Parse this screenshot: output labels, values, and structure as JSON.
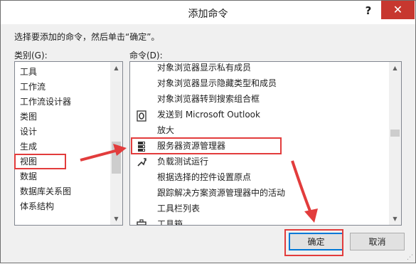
{
  "window": {
    "title": "添加命令",
    "help_label": "?",
    "close_label": "✕"
  },
  "instruction": "选择要添加的命令，然后单击“确定”。",
  "category_label": "类别(G):",
  "command_label": "命令(D):",
  "categories": [
    {
      "label": "工具"
    },
    {
      "label": "工作流"
    },
    {
      "label": "工作流设计器"
    },
    {
      "label": "类图"
    },
    {
      "label": "设计"
    },
    {
      "label": "生成"
    },
    {
      "label": "视图",
      "selected": true
    },
    {
      "label": "数据"
    },
    {
      "label": "数据库关系图"
    },
    {
      "label": "体系结构"
    }
  ],
  "commands": [
    {
      "label": "对象浏览器显示私有成员",
      "icon": ""
    },
    {
      "label": "对象浏览器显示隐藏类型和成员",
      "icon": ""
    },
    {
      "label": "对象浏览器转到搜索组合框",
      "icon": ""
    },
    {
      "label": "发送到 Microsoft Outlook",
      "icon": "outlook-icon"
    },
    {
      "label": "放大",
      "icon": ""
    },
    {
      "label": "服务器资源管理器",
      "icon": "server-explorer-icon",
      "selected": true
    },
    {
      "label": "负载测试运行",
      "icon": "load-test-icon"
    },
    {
      "label": "根据选择的控件设置原点",
      "icon": ""
    },
    {
      "label": "跟踪解决方案资源管理器中的活动",
      "icon": ""
    },
    {
      "label": "工具栏列表",
      "icon": ""
    },
    {
      "label": "工具箱",
      "icon": "toolbox-icon"
    }
  ],
  "buttons": {
    "ok": "确定",
    "cancel": "取消"
  },
  "scroll_up_glyph": "▲",
  "scroll_down_glyph": "▼",
  "colors": {
    "annotation_red": "#e23c3c",
    "close_red": "#c7372f",
    "selection_bg": "#cce8ff",
    "focus_blue": "#0078d7"
  }
}
